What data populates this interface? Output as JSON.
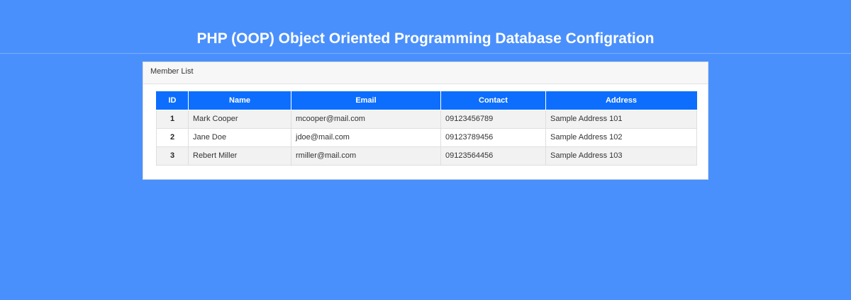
{
  "page": {
    "title": "PHP (OOP) Object Oriented Programming Database Configration"
  },
  "card": {
    "header": "Member List"
  },
  "table": {
    "columns": [
      "ID",
      "Name",
      "Email",
      "Contact",
      "Address"
    ],
    "rows": [
      [
        "1",
        "Mark Cooper",
        "mcooper@mail.com",
        "09123456789",
        "Sample Address 101"
      ],
      [
        "2",
        "Jane Doe",
        "jdoe@mail.com",
        "09123789456",
        "Sample Address 102"
      ],
      [
        "3",
        "Rebert Miller",
        "rmiller@mail.com",
        "09123564456",
        "Sample Address 103"
      ]
    ]
  },
  "colors": {
    "background": "#4a90fd",
    "table_header": "#0d6efd"
  }
}
